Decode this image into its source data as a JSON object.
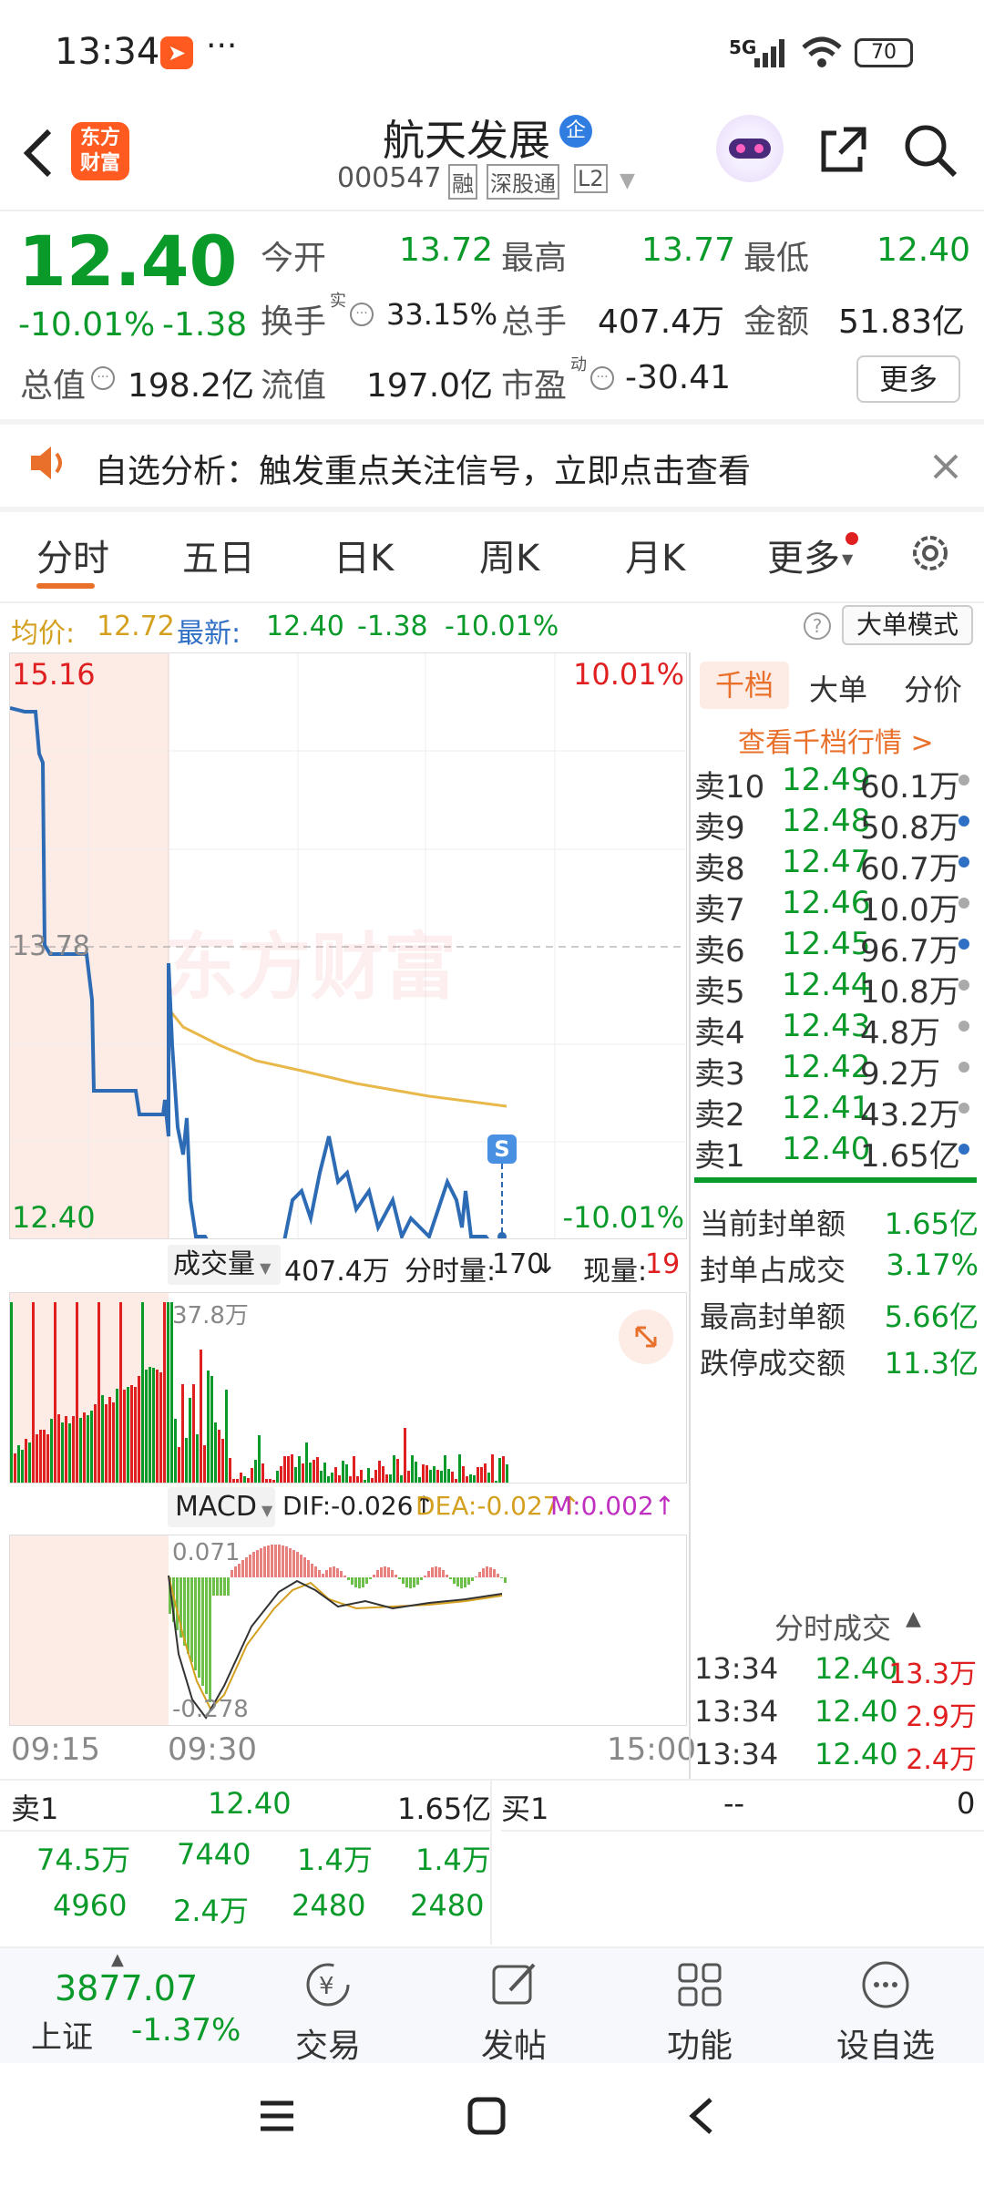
{
  "status_bar": {
    "time": "13:34",
    "more": "···",
    "network": "5G",
    "battery": "70"
  },
  "header": {
    "logo_line1": "东方",
    "logo_line2": "财富",
    "title": "航天发展",
    "title_badge": "企",
    "code": "000547",
    "tags": [
      "融",
      "深股通",
      "L2"
    ]
  },
  "quote": {
    "price": "12.40",
    "change_pct": "-10.01%",
    "change_abs": "-1.38",
    "fields": [
      {
        "label": "今开",
        "value": "13.72"
      },
      {
        "label": "最高",
        "value": "13.77"
      },
      {
        "label": "最低",
        "value": "12.40"
      },
      {
        "label": "换手",
        "value": "33.15%"
      },
      {
        "label": "总手",
        "value": "407.4万"
      },
      {
        "label": "金额",
        "value": "51.83亿"
      },
      {
        "label": "总值",
        "value": "198.2亿"
      },
      {
        "label": "流值",
        "value": "197.0亿"
      },
      {
        "label": "市盈",
        "value": "-30.41"
      }
    ],
    "turnover_sup": "实",
    "pe_sup": "动",
    "more_button": "更多"
  },
  "notice": {
    "text": "自选分析：触发重点关注信号，立即点击查看"
  },
  "tabs": [
    "分时",
    "五日",
    "日K",
    "周K",
    "月K",
    "更多"
  ],
  "info_line": {
    "avg_label": "均价:",
    "avg_value": "12.72",
    "latest_label": "最新:",
    "latest_value": "12.40",
    "chg": "-1.38",
    "chg_pct": "-10.01%",
    "mode_button": "大单模式"
  },
  "chart_labels": {
    "y_top": "15.16",
    "y_mid": "13.78",
    "y_bottom": "12.40",
    "pct_top": "10.01%",
    "pct_bottom": "-10.01%",
    "watermark": "东方财富",
    "s_marker": "S"
  },
  "volume_header": {
    "select": "成交量",
    "total": "407.4万",
    "minute_label": "分时量:",
    "minute_value": "170",
    "now_label": "现量:",
    "now_value": "19",
    "max_label": "37.8万"
  },
  "macd_header": {
    "select": "MACD",
    "dif": "DIF:-0.026↑",
    "dea": "DEA:-0.027↑",
    "m": "M:0.002↑",
    "max": "0.071",
    "min": "-0.278"
  },
  "x_axis": {
    "start": "09:15",
    "mid": "09:30",
    "end": "15:00"
  },
  "side_tabs": [
    "千档",
    "大单",
    "分价"
  ],
  "side_link": "查看千档行情 >",
  "order_book": [
    {
      "label": "卖10",
      "price": "12.49",
      "vol": "60.1万"
    },
    {
      "label": "卖9",
      "price": "12.48",
      "vol": "50.8万"
    },
    {
      "label": "卖8",
      "price": "12.47",
      "vol": "60.7万"
    },
    {
      "label": "卖7",
      "price": "12.46",
      "vol": "10.0万"
    },
    {
      "label": "卖6",
      "price": "12.45",
      "vol": "96.7万"
    },
    {
      "label": "卖5",
      "price": "12.44",
      "vol": "10.8万"
    },
    {
      "label": "卖4",
      "price": "12.43",
      "vol": "4.8万"
    },
    {
      "label": "卖3",
      "price": "12.42",
      "vol": "9.2万"
    },
    {
      "label": "卖2",
      "price": "12.41",
      "vol": "43.2万"
    },
    {
      "label": "卖1",
      "price": "12.40",
      "vol": "1.65亿"
    }
  ],
  "limit_stats": [
    {
      "label": "当前封单额",
      "value": "1.65亿"
    },
    {
      "label": "封单占成交",
      "value": "3.17%"
    },
    {
      "label": "最高封单额",
      "value": "5.66亿"
    },
    {
      "label": "跌停成交额",
      "value": "11.3亿"
    }
  ],
  "trades_title": "分时成交",
  "trades": [
    {
      "time": "13:34",
      "price": "12.40",
      "vol": "13.3万"
    },
    {
      "time": "13:34",
      "price": "12.40",
      "vol": "2.9万"
    },
    {
      "time": "13:34",
      "price": "12.40",
      "vol": "2.4万"
    }
  ],
  "queue": {
    "left_label": "卖1",
    "left_price": "12.40",
    "left_total": "1.65亿",
    "right_label": "买1",
    "right_price": "--",
    "right_total": "0",
    "row1": [
      "74.5万",
      "7440",
      "1.4万",
      "1.4万"
    ],
    "row2": [
      "4960",
      "2.4万",
      "2480",
      "2480"
    ]
  },
  "bottom_nav": {
    "index_value": "3877.07",
    "index_name": "上证",
    "index_chg": "-1.37%",
    "items": [
      "交易",
      "发帖",
      "功能",
      "设自选"
    ]
  }
}
